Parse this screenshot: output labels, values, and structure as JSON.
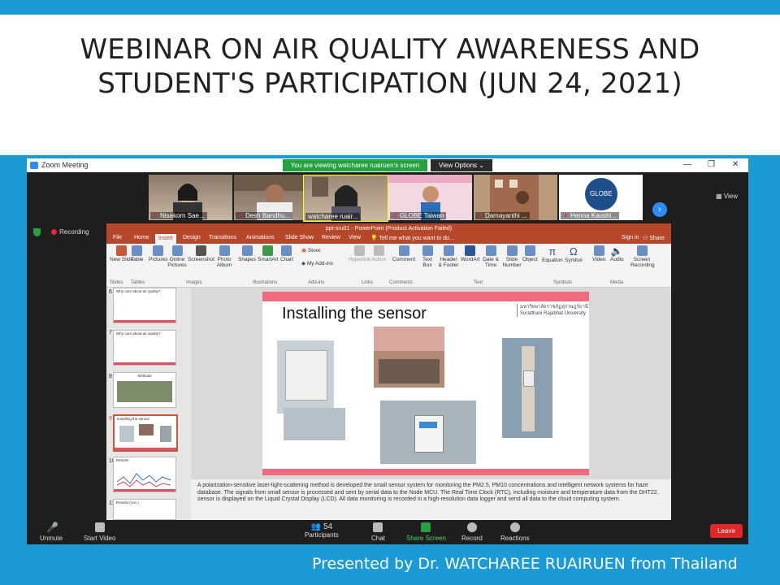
{
  "slide_title": "WEBINAR ON AIR QUALITY AWARENESS AND STUDENT'S PARTICIPATION (JUN 24, 2021)",
  "presenter_line": "Presented by Dr. WATCHAREE RUAIRUEN from Thailand",
  "colors": {
    "band": "#1b9ad6",
    "zoom_green": "#23a23f",
    "ppt_red": "#b7472a",
    "slide_pink": "#ef6b7d",
    "leave_red": "#e02828"
  },
  "zoom": {
    "window_title": "Zoom Meeting",
    "banner": "You are viewing watcharee ruairuen's screen",
    "view_options": "View Options",
    "view_button": "View",
    "recording_label": "Recording",
    "participants": [
      {
        "name": "Nisakorn Sae..."
      },
      {
        "name": "Desh Bandhu..."
      },
      {
        "name": "watcharee ruair..."
      },
      {
        "name": "GLOBE Taiwan"
      },
      {
        "name": "Damayanthi ..."
      },
      {
        "name": "Henna Kaushi..."
      }
    ],
    "toolbar": {
      "unmute": "Unmute",
      "start_video": "Start Video",
      "participants": "Participants",
      "participants_count": "54",
      "chat": "Chat",
      "share_screen": "Share Screen",
      "record": "Record",
      "reactions": "Reactions",
      "leave": "Leave"
    }
  },
  "ppt": {
    "title": "ppt-sru01 - PowerPoint (Product Activation Failed)",
    "tabs": [
      "File",
      "Home",
      "Insert",
      "Design",
      "Transitions",
      "Animations",
      "Slide Show",
      "Review",
      "View",
      "Tell me what you want to do..."
    ],
    "sign_in": "Sign in",
    "share": "Share",
    "ribbon_buttons": [
      "New Slide",
      "Table",
      "Pictures",
      "Online Pictures",
      "Screenshot",
      "Photo Album",
      "Shapes",
      "SmartArt",
      "Chart",
      "Store",
      "My Add-ins",
      "Hyperlink",
      "Action",
      "Comment",
      "Text Box",
      "Header & Footer",
      "WordArt",
      "Date & Time",
      "Slide Number",
      "Object",
      "Equation",
      "Symbol",
      "Video",
      "Audio",
      "Screen Recording"
    ],
    "ribbon_groups": [
      "Slides",
      "Tables",
      "Images",
      "Illustrations",
      "Add-ins",
      "Links",
      "Comments",
      "Text",
      "Symbols",
      "Media"
    ],
    "thumbnails": [
      {
        "num": "6",
        "title": "Why care about air quality?"
      },
      {
        "num": "7",
        "title": "Why care about air quality?"
      },
      {
        "num": "8",
        "title": "Methods"
      },
      {
        "num": "9",
        "title": "Installing the sensor"
      },
      {
        "num": "10",
        "title": "Results"
      },
      {
        "num": "11",
        "title": "Results (con.)"
      }
    ],
    "current_slide": {
      "title": "Installing the sensor",
      "university_th": "มหาวิทยาลัยราชภัฏสุราษฎร์ธานี",
      "university_en": "Suratthani Rajabhat University"
    },
    "notes": "A polarization-sensitive laser-light-scattering method is developed the small sensor system for monitoring the PM2.5, PM10 concentrations and intelligent network systems for haze database. The signals from small sensor is processed and sent by serial data to the Node MCU. The Real Time Clock (RTC), including moisture and temperature data from the DHT22, sensor is displayed on the Liquid Crystal Display (LCD). All data monitoring is recorded in a high-resolution data logger and send all data to the cloud computing system."
  }
}
